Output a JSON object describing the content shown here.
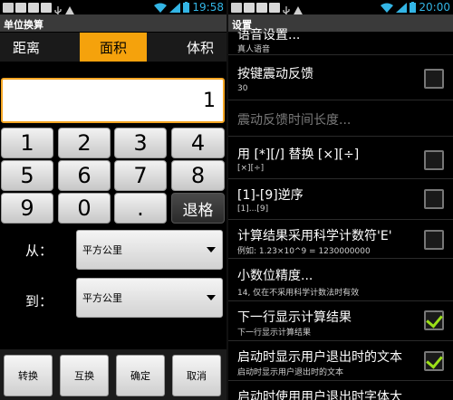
{
  "left": {
    "status": {
      "time": "19:58"
    },
    "title": "单位换算",
    "tabs": [
      "距离",
      "面积",
      "体积"
    ],
    "display_value": "1",
    "keys": {
      "k1": "1",
      "k2": "2",
      "k3": "3",
      "k4": "4",
      "k5": "5",
      "k6": "6",
      "k7": "7",
      "k8": "8",
      "k9": "9",
      "k0": "0",
      "kdot": ".",
      "back": "退格"
    },
    "from_label": "从：",
    "to_label": "到：",
    "from_unit": "平方公里",
    "to_unit": "平方公里",
    "buttons": {
      "convert": "转换",
      "swap": "互换",
      "ok": "确定",
      "cancel": "取消"
    }
  },
  "right": {
    "status": {
      "time": "20:00"
    },
    "title": "设置",
    "items": [
      {
        "title": "语音设置...",
        "summary": "真人语音"
      },
      {
        "title": "按键震动反馈",
        "summary": "30",
        "checked": false
      },
      {
        "title": "震动反馈时间长度...",
        "summary": "",
        "disabled": true
      },
      {
        "title": "用 [*][/] 替换 [×][÷]",
        "summary": "[×][÷]",
        "checked": false
      },
      {
        "title": "[1]-[9]逆序",
        "summary": "[1]...[9]",
        "checked": false
      },
      {
        "title": "计算结果采用科学计数符'E'",
        "summary": "例如: 1.23×10^9 = 1230000000",
        "checked": false
      },
      {
        "title": "小数位精度...",
        "summary": "14, 仅在不采用科学计数法时有效"
      },
      {
        "title": "下一行显示计算结果",
        "summary": "下一行显示计算结果",
        "checked": true
      },
      {
        "title": "启动时显示用户退出时的文本",
        "summary": "启动时显示用户退出时的文本",
        "checked": true
      },
      {
        "title": "启动时使用用户退出时字体大",
        "summary": ""
      }
    ]
  },
  "colors": {
    "accent": "#f5a20c",
    "check": "#9be018",
    "time": "#33b5e5"
  }
}
